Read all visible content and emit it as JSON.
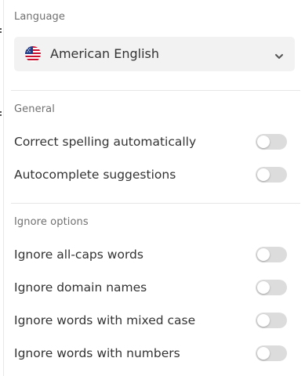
{
  "language": {
    "section_label": "Language",
    "selected": "American English",
    "flag_icon": "us-flag-icon",
    "dropdown_icon": "chevron-down-icon"
  },
  "general": {
    "section_label": "General",
    "items": [
      {
        "label": "Correct spelling automatically",
        "enabled": false
      },
      {
        "label": "Autocomplete suggestions",
        "enabled": false
      }
    ]
  },
  "ignore_options": {
    "section_label": "Ignore options",
    "items": [
      {
        "label": "Ignore all-caps words",
        "enabled": false
      },
      {
        "label": "Ignore domain names",
        "enabled": false
      },
      {
        "label": "Ignore words with mixed case",
        "enabled": false
      },
      {
        "label": "Ignore words with numbers",
        "enabled": false
      }
    ]
  },
  "colors": {
    "toggle_off": "#dcdcdc",
    "select_bg": "#f2f2f2",
    "label_gray": "#707070"
  }
}
